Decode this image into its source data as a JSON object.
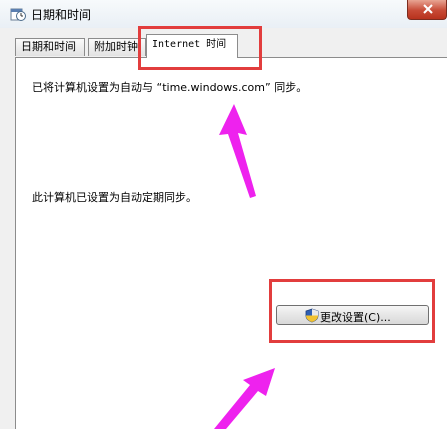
{
  "window": {
    "title": "日期和时间",
    "icon": "clock-calendar-icon",
    "close_icon": "close-icon"
  },
  "tabs": [
    {
      "label": "日期和时间",
      "active": false
    },
    {
      "label": "附加时钟",
      "active": false
    },
    {
      "label": "Internet 时间",
      "active": true
    }
  ],
  "content": {
    "sync_server_text": "已将计算机设置为自动与 “time.windows.com” 同步。",
    "auto_sync_text": "此计算机已设置为自动定期同步。",
    "change_settings_button": "更改设置(C)...",
    "button_icon": "uac-shield-icon"
  },
  "annotations": {
    "highlight_color": "#e23d3d",
    "arrow_color": "#ee22ee"
  }
}
